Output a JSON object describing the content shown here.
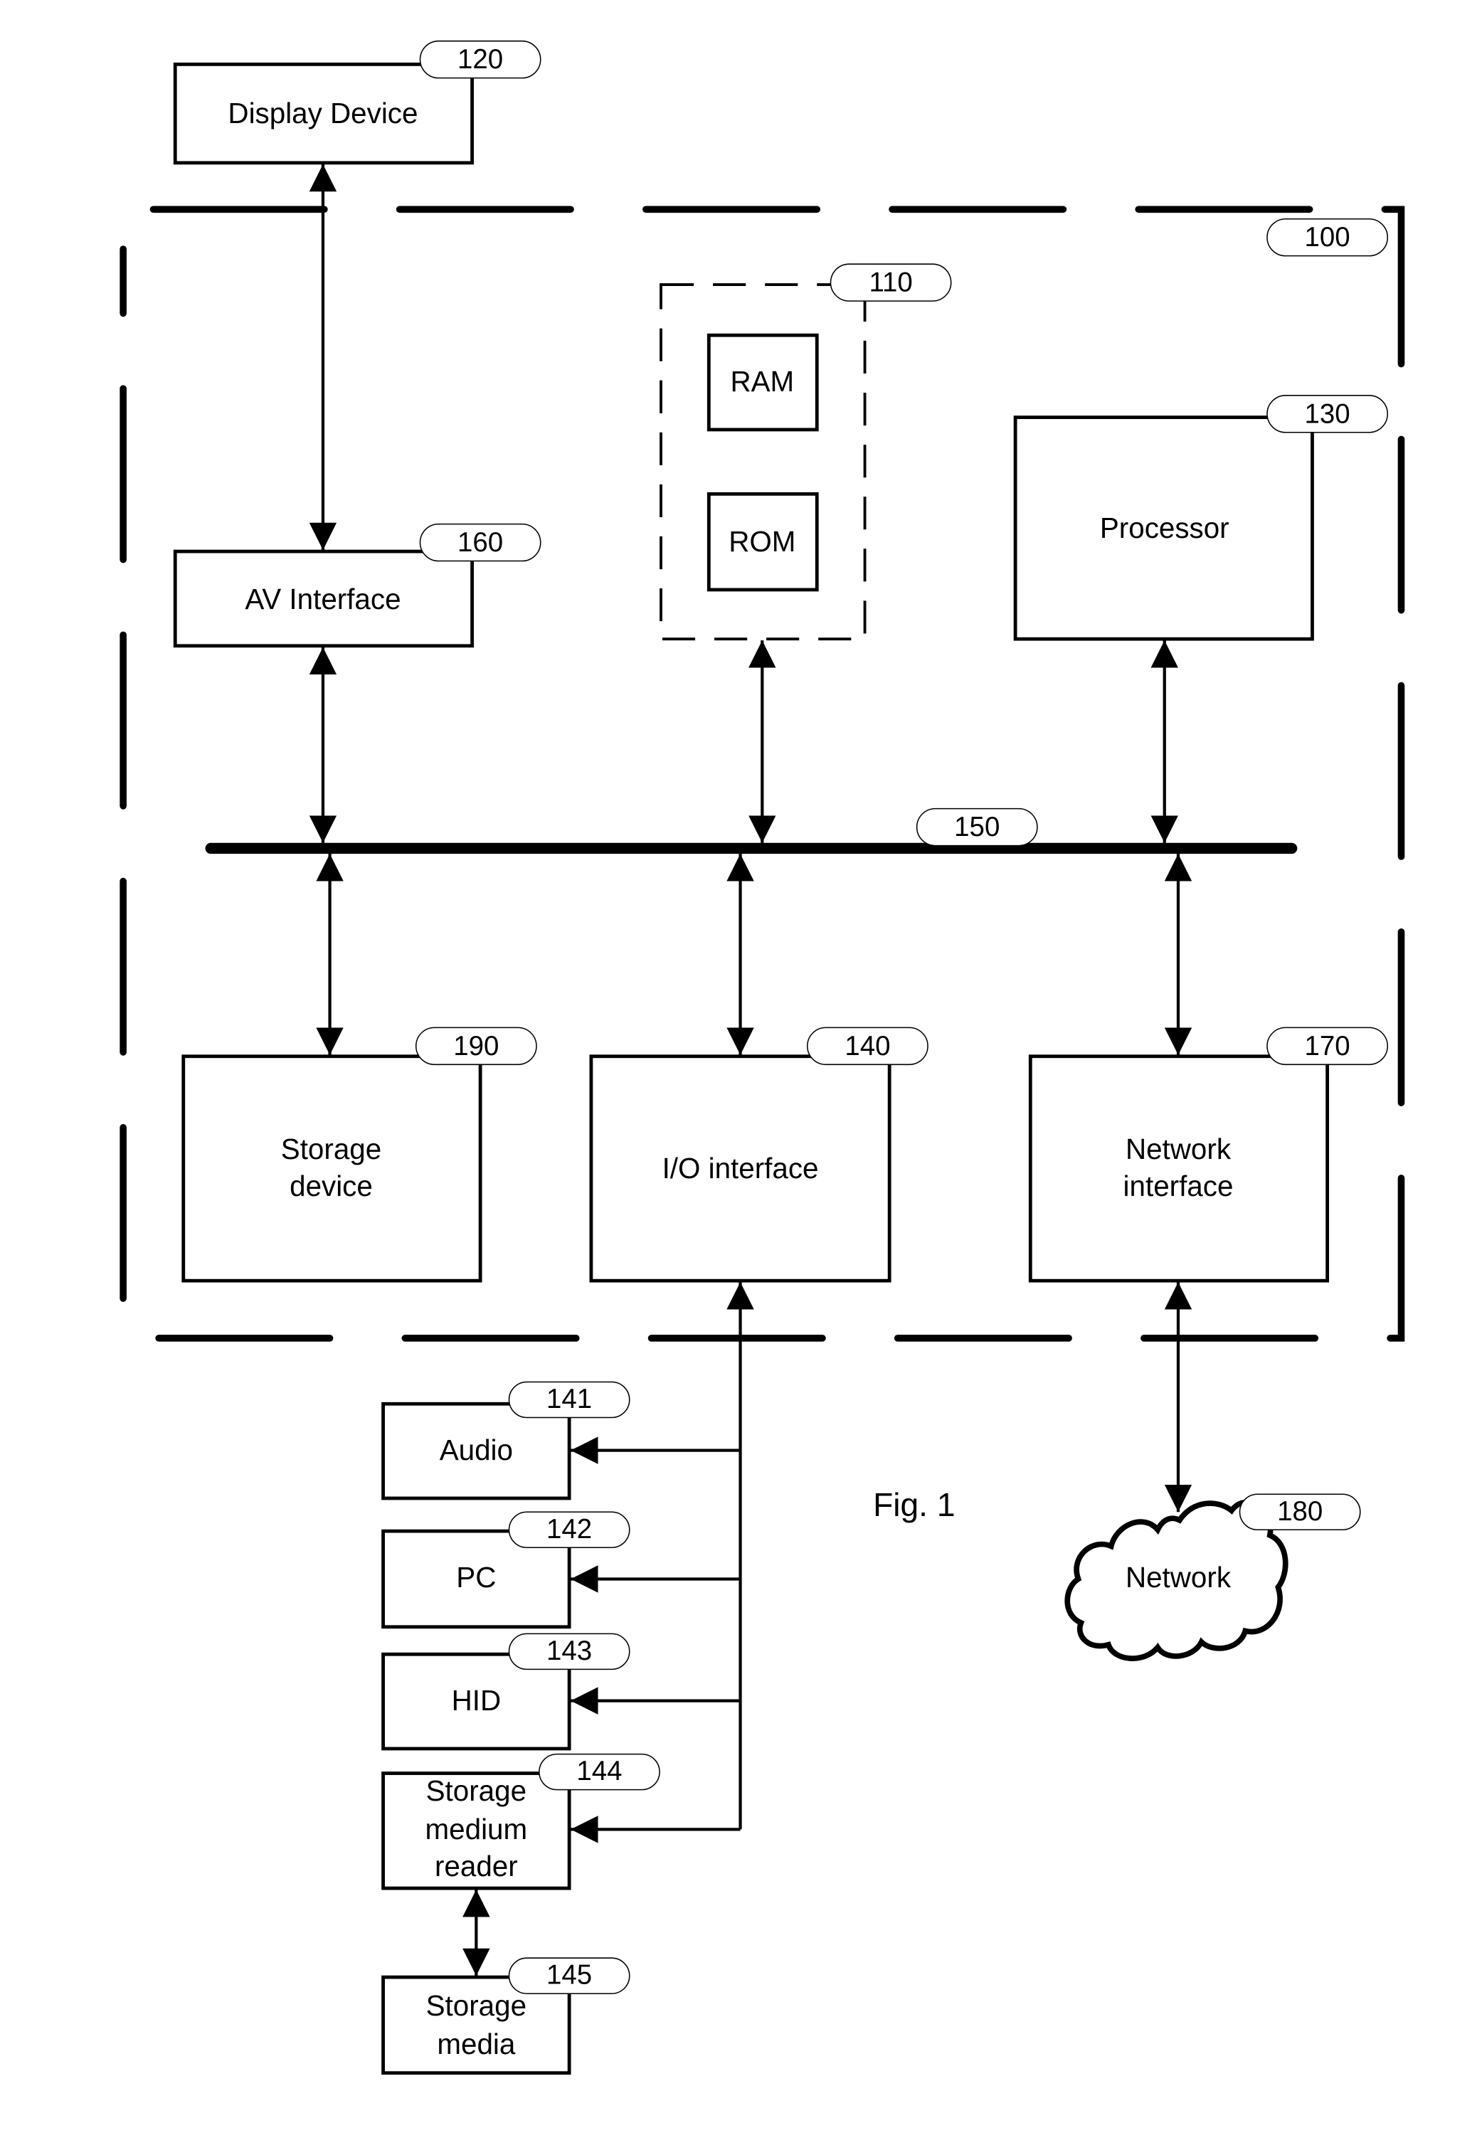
{
  "figure": {
    "caption": "Fig. 1"
  },
  "system": {
    "ref": "100"
  },
  "memory": {
    "ref": "110",
    "ram_label": "RAM",
    "rom_label": "ROM"
  },
  "display_device": {
    "label": "Display Device",
    "ref": "120"
  },
  "processor": {
    "label": "Processor",
    "ref": "130"
  },
  "io_interface": {
    "label": "I/O interface",
    "ref": "140"
  },
  "bus": {
    "ref": "150"
  },
  "av_interface": {
    "label": "AV Interface",
    "ref": "160"
  },
  "network_interface": {
    "label_line1": "Network",
    "label_line2": "interface",
    "ref": "170"
  },
  "network": {
    "label": "Network",
    "ref": "180"
  },
  "storage_device": {
    "label_line1": "Storage",
    "label_line2": "device",
    "ref": "190"
  },
  "peripherals": {
    "audio": {
      "label": "Audio",
      "ref": "141"
    },
    "pc": {
      "label": "PC",
      "ref": "142"
    },
    "hid": {
      "label": "HID",
      "ref": "143"
    },
    "reader": {
      "label_line1": "Storage",
      "label_line2": "medium",
      "label_line3": "reader",
      "ref": "144"
    },
    "media": {
      "label_line1": "Storage",
      "label_line2": "media",
      "ref": "145"
    }
  }
}
